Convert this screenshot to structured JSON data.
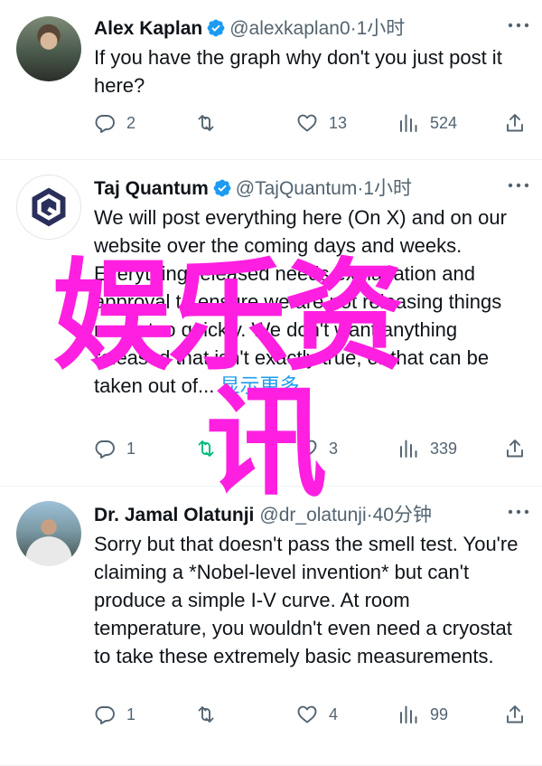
{
  "tweets": [
    {
      "name": "Alex Kaplan",
      "handle": "@alexkaplan0",
      "time": "·1小时",
      "text": "If you have the graph why don't you just post it here?",
      "replies": "2",
      "retweets": "",
      "likes": "13",
      "views": "524"
    },
    {
      "name": "Taj Quantum",
      "handle": "@TajQuantum",
      "time": "·1小时",
      "text": "We will post everything here (On X) and on our website over the coming days and weeks. Everything released needs explanation and approval to ensure we are not releasing things much too quickly. We don't want anything released that isn't exactly true, or that can be taken out of...",
      "show_more": "显示更多",
      "replies": "1",
      "retweets": "1",
      "likes": "3",
      "views": "339"
    },
    {
      "name": "Dr. Jamal Olatunji",
      "handle": "@dr_olatunji",
      "time": "·40分钟",
      "text": "Sorry but that doesn't pass the smell test. You're claiming a *Nobel-level invention* but can't produce a simple I-V curve. At room temperature, you wouldn't even need a cryostat to take these extremely basic measurements.",
      "replies": "1",
      "retweets": "",
      "likes": "4",
      "views": "99"
    }
  ],
  "watermark": {
    "line1": "娱乐资",
    "line2": "讯"
  },
  "colors": {
    "text": "#0f1419",
    "secondary": "#536471",
    "link": "#1d9bf0",
    "verified": "#1d9bf0",
    "retweet_active": "#00ba7c",
    "watermark": "#ff1fe0"
  },
  "icons": [
    "reply-icon",
    "retweet-icon",
    "like-icon",
    "views-icon",
    "share-icon",
    "verified-badge-icon",
    "more-icon"
  ]
}
